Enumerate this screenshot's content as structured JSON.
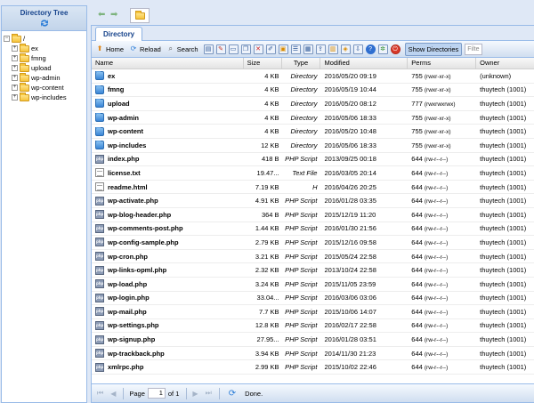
{
  "tree": {
    "title": "Directory Tree",
    "root_label": "/",
    "children": [
      "ex",
      "fmng",
      "upload",
      "wp-admin",
      "wp-content",
      "wp-includes"
    ]
  },
  "nav": {
    "back": "⬅",
    "forward": "➡"
  },
  "tab": {
    "label": "Directory"
  },
  "toolbar": {
    "home": "Home",
    "reload": "Reload",
    "search": "Search",
    "show_directories": "Show Directories",
    "filter_placeholder": "Filte"
  },
  "columns": {
    "name": "Name",
    "size": "Size",
    "type": "Type",
    "modified": "Modified",
    "perms": "Perms",
    "owner": "Owner"
  },
  "rows": [
    {
      "name": "ex",
      "icon": "dir",
      "size": "4 KB",
      "type": "Directory",
      "modified": "2016/05/20 09:19",
      "perm": "755",
      "perm_str": "(rwxr-xr-x)",
      "owner": "(unknown)"
    },
    {
      "name": "fmng",
      "icon": "dir",
      "size": "4 KB",
      "type": "Directory",
      "modified": "2016/05/19 10:44",
      "perm": "755",
      "perm_str": "(rwxr-xr-x)",
      "owner": "thuytech (1001)"
    },
    {
      "name": "upload",
      "icon": "dir",
      "size": "4 KB",
      "type": "Directory",
      "modified": "2016/05/20 08:12",
      "perm": "777",
      "perm_str": "(rwxrwxrwx)",
      "owner": "thuytech (1001)"
    },
    {
      "name": "wp-admin",
      "icon": "dir",
      "size": "4 KB",
      "type": "Directory",
      "modified": "2016/05/06 18:33",
      "perm": "755",
      "perm_str": "(rwxr-xr-x)",
      "owner": "thuytech (1001)"
    },
    {
      "name": "wp-content",
      "icon": "dir",
      "size": "4 KB",
      "type": "Directory",
      "modified": "2016/05/20 10:48",
      "perm": "755",
      "perm_str": "(rwxr-xr-x)",
      "owner": "thuytech (1001)"
    },
    {
      "name": "wp-includes",
      "icon": "dir",
      "size": "12 KB",
      "type": "Directory",
      "modified": "2016/05/06 18:33",
      "perm": "755",
      "perm_str": "(rwxr-xr-x)",
      "owner": "thuytech (1001)"
    },
    {
      "name": "index.php",
      "icon": "php",
      "size": "418 B",
      "type": "PHP Script",
      "modified": "2013/09/25 00:18",
      "perm": "644",
      "perm_str": "(rw-r--r--)",
      "owner": "thuytech (1001)"
    },
    {
      "name": "license.txt",
      "icon": "txt",
      "size": "19.47...",
      "type": "Text File",
      "modified": "2016/03/05 20:14",
      "perm": "644",
      "perm_str": "(rw-r--r--)",
      "owner": "thuytech (1001)"
    },
    {
      "name": "readme.html",
      "icon": "txt",
      "size": "7.19 KB",
      "type": "H",
      "modified": "2016/04/26 20:25",
      "perm": "644",
      "perm_str": "(rw-r--r--)",
      "owner": "thuytech (1001)"
    },
    {
      "name": "wp-activate.php",
      "icon": "php",
      "size": "4.91 KB",
      "type": "PHP Script",
      "modified": "2016/01/28 03:35",
      "perm": "644",
      "perm_str": "(rw-r--r--)",
      "owner": "thuytech (1001)"
    },
    {
      "name": "wp-blog-header.php",
      "icon": "php",
      "size": "364 B",
      "type": "PHP Script",
      "modified": "2015/12/19 11:20",
      "perm": "644",
      "perm_str": "(rw-r--r--)",
      "owner": "thuytech (1001)"
    },
    {
      "name": "wp-comments-post.php",
      "icon": "php",
      "size": "1.44 KB",
      "type": "PHP Script",
      "modified": "2016/01/30 21:56",
      "perm": "644",
      "perm_str": "(rw-r--r--)",
      "owner": "thuytech (1001)"
    },
    {
      "name": "wp-config-sample.php",
      "icon": "php",
      "size": "2.79 KB",
      "type": "PHP Script",
      "modified": "2015/12/16 09:58",
      "perm": "644",
      "perm_str": "(rw-r--r--)",
      "owner": "thuytech (1001)"
    },
    {
      "name": "wp-cron.php",
      "icon": "php",
      "size": "3.21 KB",
      "type": "PHP Script",
      "modified": "2015/05/24 22:58",
      "perm": "644",
      "perm_str": "(rw-r--r--)",
      "owner": "thuytech (1001)"
    },
    {
      "name": "wp-links-opml.php",
      "icon": "php",
      "size": "2.32 KB",
      "type": "PHP Script",
      "modified": "2013/10/24 22:58",
      "perm": "644",
      "perm_str": "(rw-r--r--)",
      "owner": "thuytech (1001)"
    },
    {
      "name": "wp-load.php",
      "icon": "php",
      "size": "3.24 KB",
      "type": "PHP Script",
      "modified": "2015/11/05 23:59",
      "perm": "644",
      "perm_str": "(rw-r--r--)",
      "owner": "thuytech (1001)"
    },
    {
      "name": "wp-login.php",
      "icon": "php",
      "size": "33.04...",
      "type": "PHP Script",
      "modified": "2016/03/06 03:06",
      "perm": "644",
      "perm_str": "(rw-r--r--)",
      "owner": "thuytech (1001)"
    },
    {
      "name": "wp-mail.php",
      "icon": "php",
      "size": "7.7 KB",
      "type": "PHP Script",
      "modified": "2015/10/06 14:07",
      "perm": "644",
      "perm_str": "(rw-r--r--)",
      "owner": "thuytech (1001)"
    },
    {
      "name": "wp-settings.php",
      "icon": "php",
      "size": "12.8 KB",
      "type": "PHP Script",
      "modified": "2016/02/17 22:58",
      "perm": "644",
      "perm_str": "(rw-r--r--)",
      "owner": "thuytech (1001)"
    },
    {
      "name": "wp-signup.php",
      "icon": "php",
      "size": "27.95...",
      "type": "PHP Script",
      "modified": "2016/01/28 03:51",
      "perm": "644",
      "perm_str": "(rw-r--r--)",
      "owner": "thuytech (1001)"
    },
    {
      "name": "wp-trackback.php",
      "icon": "php",
      "size": "3.94 KB",
      "type": "PHP Script",
      "modified": "2014/11/30 21:23",
      "perm": "644",
      "perm_str": "(rw-r--r--)",
      "owner": "thuytech (1001)"
    },
    {
      "name": "xmlrpc.php",
      "icon": "php",
      "size": "2.99 KB",
      "type": "PHP Script",
      "modified": "2015/10/02 22:46",
      "perm": "644",
      "perm_str": "(rw-r--r--)",
      "owner": "thuytech (1001)"
    }
  ],
  "pager": {
    "page_label": "Page",
    "page_value": "1",
    "of_label": "of 1",
    "status": "Done."
  },
  "icons": {
    "php_glyph": "php"
  }
}
